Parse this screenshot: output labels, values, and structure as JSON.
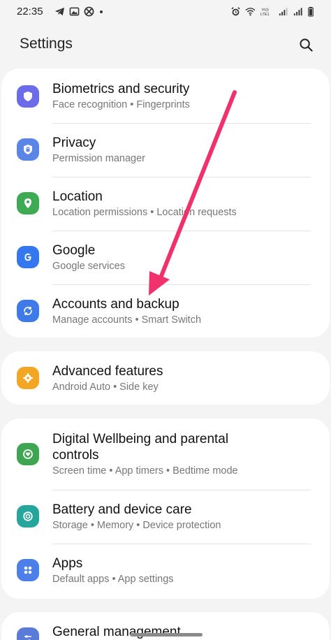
{
  "status_bar": {
    "time": "22:35",
    "left_icons": [
      "telegram-icon",
      "image-icon",
      "xbox-icon"
    ],
    "right_icons": [
      "alarm-icon",
      "wifi-icon",
      "volte-icon",
      "signal-icon",
      "battery-icon"
    ],
    "volte_label": "Vo)) LTE1"
  },
  "header": {
    "title": "Settings",
    "search_icon": "search-icon"
  },
  "groups": [
    {
      "items": [
        {
          "title": "Biometrics and security",
          "subtitle": "Face recognition  •  Fingerprints",
          "icon": "shield-icon",
          "color": "#6b6de8"
        },
        {
          "title": "Privacy",
          "subtitle": "Permission manager",
          "icon": "privacy-icon",
          "color": "#5b86e8"
        },
        {
          "title": "Location",
          "subtitle": "Location permissions  •  Location requests",
          "icon": "location-pin-icon",
          "color": "#3dab53"
        },
        {
          "title": "Google",
          "subtitle": "Google services",
          "icon": "google-icon",
          "color": "#3478f0"
        },
        {
          "title": "Accounts and backup",
          "subtitle": "Manage accounts  •  Smart Switch",
          "icon": "sync-icon",
          "color": "#3f7be8"
        }
      ]
    },
    {
      "items": [
        {
          "title": "Advanced features",
          "subtitle": "Android Auto  •  Side key",
          "icon": "gear-plus-icon",
          "color": "#f2a623"
        }
      ]
    },
    {
      "items": [
        {
          "title": "Digital Wellbeing and parental controls",
          "title_line1": "Digital Wellbeing and parental",
          "title_line2": "controls",
          "subtitle": "Screen time  •  App timers  •  Bedtime mode",
          "icon": "wellbeing-heart-icon",
          "color": "#3ea653"
        },
        {
          "title": "Battery and device care",
          "subtitle": "Storage  •  Memory  •  Device protection",
          "icon": "device-care-icon",
          "color": "#25a59c"
        },
        {
          "title": "Apps",
          "subtitle": "Default apps  •  App settings",
          "icon": "apps-grid-icon",
          "color": "#4c7fe8"
        }
      ]
    },
    {
      "items": [
        {
          "title": "General management",
          "icon": "sliders-icon",
          "color": "#5b7bd8"
        }
      ]
    }
  ],
  "annotation": {
    "arrow_color": "#f0316b",
    "points_to": "Accounts and backup"
  }
}
